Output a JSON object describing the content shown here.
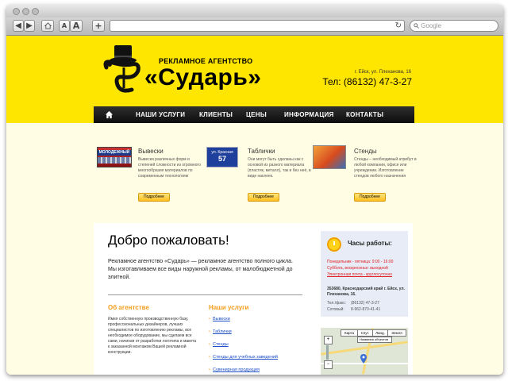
{
  "browser": {
    "nav_back": "◀",
    "nav_forward": "▶",
    "font_small": "A",
    "font_large": "A",
    "add_tab": "+",
    "reload": "↻",
    "search_placeholder": "Google"
  },
  "header": {
    "agency_subtitle": "РЕКЛАМНОЕ АГЕНТСТВО",
    "agency_name": "«Сударь»",
    "address": "г. Ейск, ул. Плеханова, 16",
    "phone": "Тел: (86132) 47-3-27"
  },
  "menu": {
    "items": [
      "НАШИ УСЛУГИ",
      "КЛИЕНТЫ",
      "ЦЕНЫ",
      "ИНФОРМАЦИЯ",
      "КОНТАКТЫ"
    ]
  },
  "services": [
    {
      "title": "Вывески",
      "thumb_text": "МОЛОДЕЖНЫЙ",
      "desc": "Вывески различных форм и степеней сложности из огромного многообразия материалов по современным технологиям",
      "button": "Подробнее"
    },
    {
      "title": "Таблички",
      "thumb_text": "ул. Красная",
      "thumb_number": "57",
      "desc": "Они могут быть сделаны как с основой из разного материала (пластик, металл), так и без неё, в виде наклеек.",
      "button": "Подробнее"
    },
    {
      "title": "Стенды",
      "desc": "Стенды – необходимый атрибут в любой компании, офисе или учреждении. Изготовление стендов любого назначения",
      "button": "Подробнее"
    }
  ],
  "content": {
    "welcome": "Добро пожаловать!",
    "intro": "Рекламное агентство «Сударь» — рекламное агентство полного цикла. Мы изготавливаем все виды наружной рекламы, от малобюджетной до элитной.",
    "about_title": "Об агентстве",
    "about_text": "Имея собственную производственную базу, профессиональных дизайнеров, лучших специалистов по изготовлению рекламы, все необходимое оборудование, мы сделаем все сами, начиная от разработки логотипа и макета к заказанной монтажом Вашей рекламной конструкции.",
    "services_title": "Наши услуги",
    "service_links": [
      "Вывески",
      "Таблички",
      "Стенды",
      "Стенды для учебных заведений",
      "Сувенирная продукция"
    ]
  },
  "hours": {
    "title": "Часы работы:",
    "weekdays": "Понедельник - пятница: 9:00 - 16:00",
    "weekend": "Суббота, воскресенье: выходной",
    "email": "Электронная почта - круглосуточно",
    "address": "353680, Краснодарский край г. Ейск, ул. Плеханова, 16.",
    "tel_label": "Тел./факс:",
    "tel_value": "(86132) 47-3-27",
    "mobile_label": "Сотовый:",
    "mobile_value": "8-962-870-41-41"
  },
  "map": {
    "btn_map": "Карта",
    "btn_sat": "Спут.",
    "btn_land": "Ланд.",
    "btn_earth": "Земля",
    "objects_label": "Названия объектов"
  }
}
